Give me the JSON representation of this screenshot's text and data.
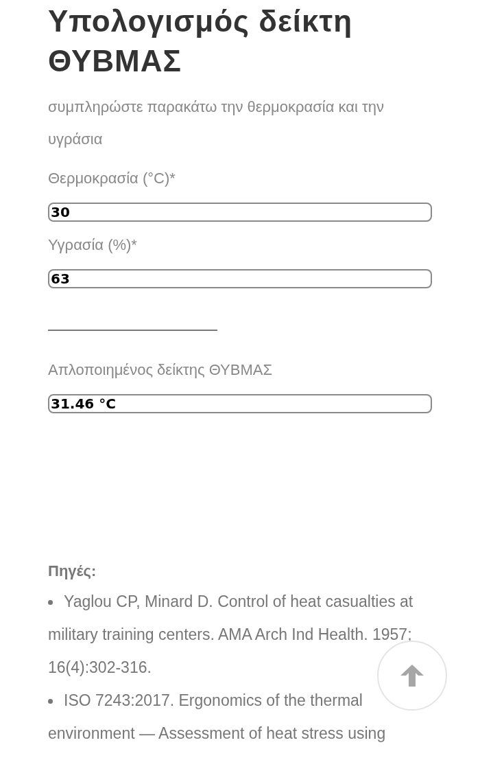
{
  "title": "Υπολογισμός δείκτη ΘΥΒΜΑΣ",
  "intro": "συμπληρώστε παρακάτω την θερμοκρασία και την υγράσια",
  "fields": [
    {
      "label": "Θερμοκρασία (°C)*",
      "value": "30"
    },
    {
      "label": "Υγρασία (%)*",
      "value": "63"
    }
  ],
  "result": {
    "label": "Απλοποιημένος δείκτης ΘΥΒΜΑΣ",
    "value": "31.46 °C"
  },
  "sources": {
    "heading": "Πηγές:",
    "items": [
      "Yaglou CP, Minard D. Control of heat casualties at military training centers. AMA Arch Ind Health. 1957; 16(4):302-316.",
      "ISO 7243:2017. Ergonomics of the thermal environment — Assessment of heat stress using"
    ]
  }
}
